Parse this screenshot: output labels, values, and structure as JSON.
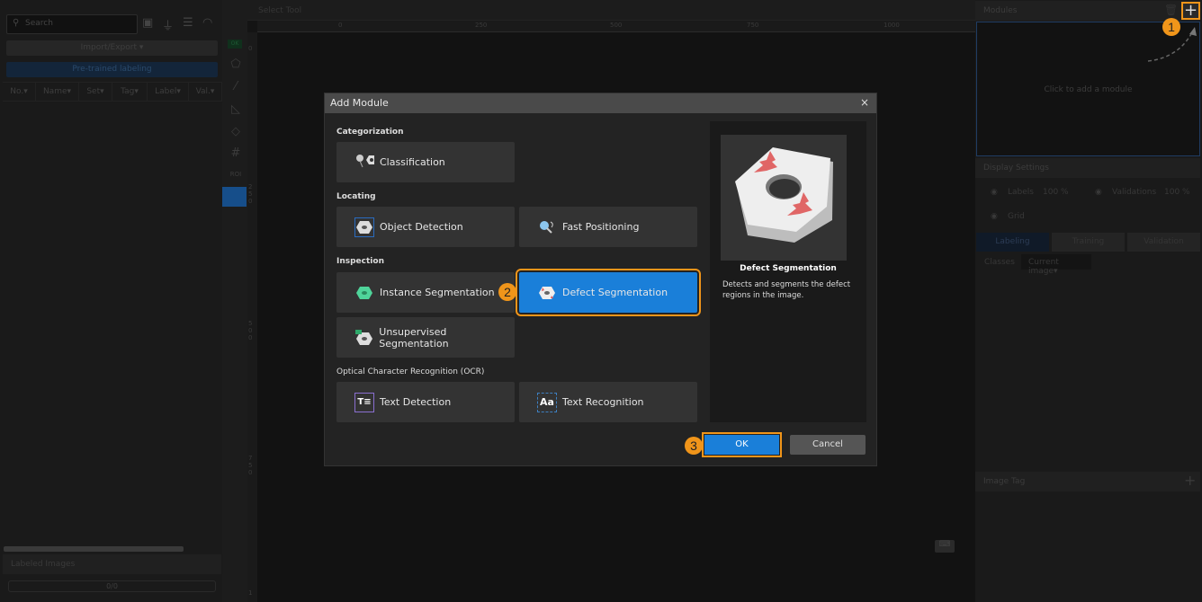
{
  "left_panel": {
    "search_placeholder": "Search",
    "import_export": "Import/Export ▾",
    "pretrained": "Pre-trained labeling",
    "columns": [
      "No.▾",
      "Name▾",
      "Set▾",
      "Tag▾",
      "Label▾",
      "Val.▾"
    ],
    "labeled_images": "Labeled Images",
    "progress": "0/0"
  },
  "tools": {
    "ok_tag": "OK",
    "roi": "ROI"
  },
  "canvas": {
    "title": "Select Tool",
    "hruler": [
      "0",
      "250",
      "500",
      "750",
      "1000"
    ],
    "vruler": [
      "0",
      "250",
      "500",
      "750",
      "1"
    ]
  },
  "right_panel": {
    "modules_title": "Modules",
    "add_hint": "Click to add a module",
    "display_settings": "Display Settings",
    "labels": "Labels",
    "labels_pct": "100 %",
    "validations": "Validations",
    "validations_pct": "100 %",
    "grid": "Grid",
    "tabs": [
      "Labeling",
      "Training",
      "Validation"
    ],
    "classes": "Classes",
    "classes_filter": "Current image▾",
    "image_tag": "Image Tag"
  },
  "steps": [
    "1",
    "2",
    "3"
  ],
  "accent": "#f0951a",
  "selected_color": "#1a7fd9",
  "dialog": {
    "title": "Add Module",
    "close": "×",
    "sections": [
      {
        "name": "Categorization",
        "modules": [
          "Classification"
        ]
      },
      {
        "name": "Locating",
        "modules": [
          "Object Detection",
          "Fast Positioning"
        ]
      },
      {
        "name": "Inspection",
        "modules": [
          "Instance Segmentation",
          "Defect Segmentation",
          "Unsupervised Segmentation"
        ]
      },
      {
        "name": "Optical Character Recognition (OCR)",
        "modules": [
          "Text Detection",
          "Text Recognition"
        ]
      }
    ],
    "selected": "Defect Segmentation",
    "preview_title": "Defect Segmentation",
    "preview_desc": "Detects and segments the defect regions in the image.",
    "ok": "OK",
    "cancel": "Cancel"
  }
}
